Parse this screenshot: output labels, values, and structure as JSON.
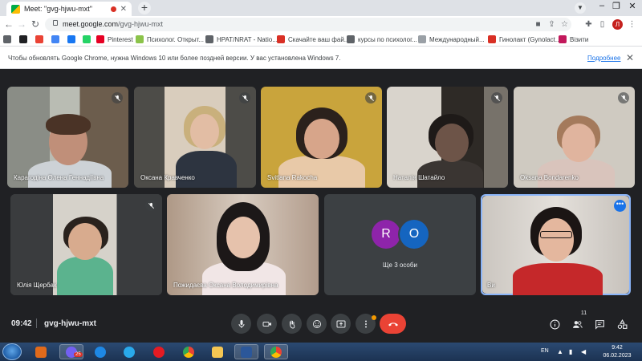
{
  "browser": {
    "tab_title": "Meet: \"gvg-hjwu-mxt\"",
    "url_host": "meet.google.com",
    "url_path": "/gvg-hjwu-mxt",
    "profile_initial": "Л",
    "bookmarks": [
      {
        "label": "",
        "icon": "apps-icon",
        "color": "#5f6368"
      },
      {
        "label": "",
        "icon": "blog-icon",
        "color": "#202124"
      },
      {
        "label": "",
        "icon": "gmail-icon",
        "color": "#ea4335"
      },
      {
        "label": "",
        "icon": "translate-icon",
        "color": "#4285f4"
      },
      {
        "label": "",
        "icon": "facebook-icon",
        "color": "#1877f2"
      },
      {
        "label": "",
        "icon": "whatsapp-icon",
        "color": "#25d366"
      },
      {
        "label": "Pinterest",
        "icon": "pinterest-icon",
        "color": "#e60023"
      },
      {
        "label": "Психолог. Открыт...",
        "icon": "leaf-icon",
        "color": "#8bc34a"
      },
      {
        "label": "HPAT/NRAT - Natio...",
        "icon": "book-icon",
        "color": "#5f6368"
      },
      {
        "label": "Скачайте ваш фай...",
        "icon": "download-icon",
        "color": "#d93025"
      },
      {
        "label": "курсы по психолог...",
        "icon": "globe-icon",
        "color": "#5f6368"
      },
      {
        "label": "Международный...",
        "icon": "page-icon",
        "color": "#9aa0a6"
      },
      {
        "label": "Гинолакт (Gynolact...",
        "icon": "cross-icon",
        "color": "#d93025"
      },
      {
        "label": "Візити",
        "icon": "visits-icon",
        "color": "#c2185b"
      }
    ],
    "infobar_text": "Чтобы обновлять Google Chrome, нужна Windows 10 или более поздней версии. У вас установлена Windows 7.",
    "infobar_link": "Подробнее"
  },
  "tiles": [
    {
      "name": "Карагодіна Олена Геннадіївна",
      "muted": true
    },
    {
      "name": "Оксана Кравченко",
      "muted": true
    },
    {
      "name": "Svitlana Rakocha",
      "muted": true
    },
    {
      "name": "Наталія Шатайло",
      "muted": true
    },
    {
      "name": "Oksana Bondarenko",
      "muted": true
    },
    {
      "name": "Юлія Щербак",
      "muted": true
    },
    {
      "name": "Пожидаєва Оксана Володимирівна",
      "muted": false
    },
    {
      "name": "Ще 3 особи",
      "avatars": [
        "R",
        "O"
      ],
      "avatar_colors": [
        "#8e24aa",
        "#1565c0"
      ]
    },
    {
      "name": "Ви",
      "self": true
    }
  ],
  "meeting": {
    "time": "09:42",
    "code": "gvg-hjwu-mxt",
    "participant_count": "11"
  },
  "colors": {
    "meet_bg": "#202124",
    "end_call": "#ea4335",
    "self_tile_border": "#8ab4f8"
  },
  "taskbar": {
    "language": "EN",
    "clock_time": "9:42",
    "clock_date": "06.02.2023",
    "notification_badge": "25"
  }
}
